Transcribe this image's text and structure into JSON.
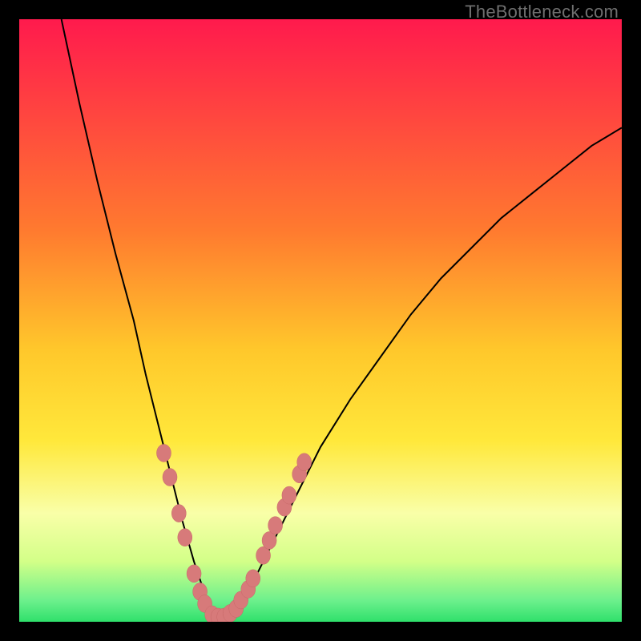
{
  "watermark": "TheBottleneck.com",
  "colors": {
    "black": "#000000",
    "curve": "#000000",
    "marker_fill": "#d77a7a",
    "marker_stroke": "#c76868",
    "grad_top": "#ff1a4d",
    "grad_orange": "#ff9b2a",
    "grad_yellow": "#ffe83b",
    "grad_pale": "#f9ffa8",
    "grad_green": "#2fe06b"
  },
  "chart_data": {
    "type": "line",
    "title": "",
    "xlabel": "",
    "ylabel": "",
    "xlim": [
      0,
      100
    ],
    "ylim": [
      0,
      100
    ],
    "series": [
      {
        "name": "bottleneck-curve",
        "x": [
          7,
          10,
          13,
          16,
          19,
          21,
          23,
          25,
          27,
          29,
          30,
          31,
          32,
          33,
          34,
          36,
          38,
          40,
          42,
          45,
          50,
          55,
          60,
          65,
          70,
          75,
          80,
          85,
          90,
          95,
          100
        ],
        "y": [
          100,
          86,
          73,
          61,
          50,
          41,
          33,
          25,
          17,
          10,
          7,
          4,
          2,
          1,
          1,
          2,
          5,
          9,
          13,
          19,
          29,
          37,
          44,
          51,
          57,
          62,
          67,
          71,
          75,
          79,
          82
        ]
      }
    ],
    "markers": {
      "name": "highlighted-points",
      "points": [
        {
          "x": 24,
          "y": 28
        },
        {
          "x": 25,
          "y": 24
        },
        {
          "x": 26.5,
          "y": 18
        },
        {
          "x": 27.5,
          "y": 14
        },
        {
          "x": 29,
          "y": 8
        },
        {
          "x": 30,
          "y": 5
        },
        {
          "x": 30.8,
          "y": 3
        },
        {
          "x": 32,
          "y": 1.2
        },
        {
          "x": 33,
          "y": 0.8
        },
        {
          "x": 34,
          "y": 0.8
        },
        {
          "x": 35,
          "y": 1.4
        },
        {
          "x": 36,
          "y": 2.2
        },
        {
          "x": 36.8,
          "y": 3.6
        },
        {
          "x": 38,
          "y": 5.4
        },
        {
          "x": 38.8,
          "y": 7.2
        },
        {
          "x": 40.5,
          "y": 11
        },
        {
          "x": 41.5,
          "y": 13.5
        },
        {
          "x": 42.5,
          "y": 16
        },
        {
          "x": 44,
          "y": 19
        },
        {
          "x": 44.8,
          "y": 21
        },
        {
          "x": 46.5,
          "y": 24.5
        },
        {
          "x": 47.3,
          "y": 26.5
        }
      ]
    },
    "background_gradient": [
      {
        "offset": 0.0,
        "color": "#ff1a4d"
      },
      {
        "offset": 0.35,
        "color": "#ff7a2f"
      },
      {
        "offset": 0.55,
        "color": "#ffc82b"
      },
      {
        "offset": 0.7,
        "color": "#ffe83b"
      },
      {
        "offset": 0.82,
        "color": "#f9ffa8"
      },
      {
        "offset": 0.9,
        "color": "#d3ff88"
      },
      {
        "offset": 0.965,
        "color": "#6cf08c"
      },
      {
        "offset": 1.0,
        "color": "#2fe06b"
      }
    ]
  }
}
